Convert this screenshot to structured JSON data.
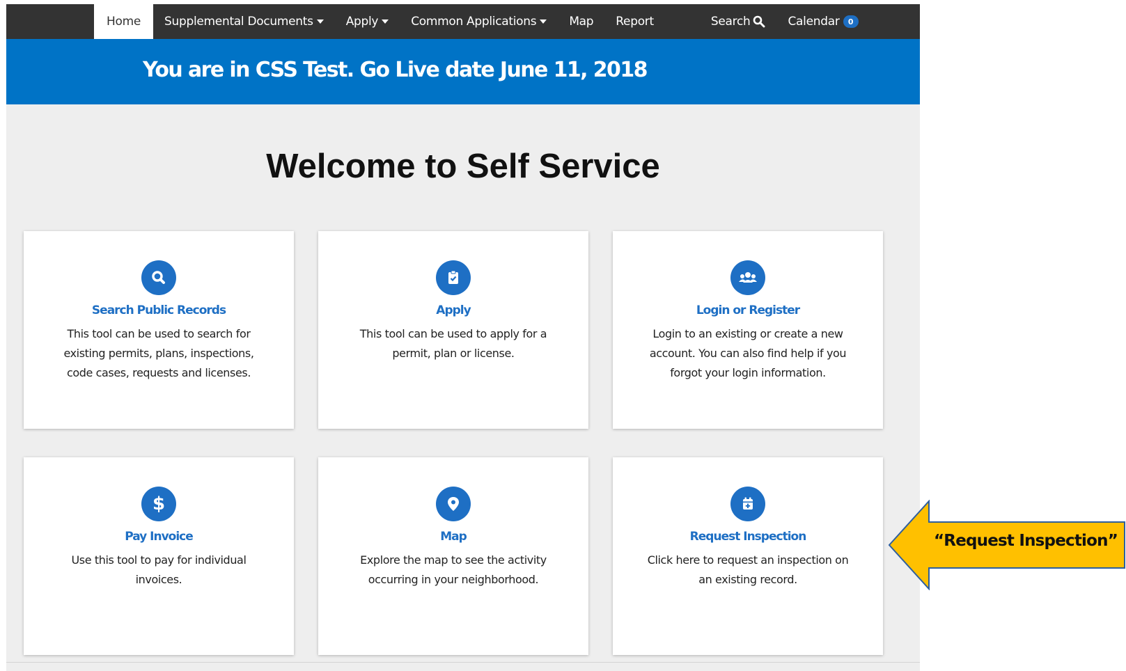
{
  "nav": {
    "home": "Home",
    "supplemental": "Supplemental Documents",
    "apply": "Apply",
    "common": "Common Applications",
    "map": "Map",
    "report": "Report",
    "search": "Search",
    "calendar": "Calendar",
    "calendar_count": "0"
  },
  "banner": {
    "text": "You are in CSS Test.  Go Live date June 11, 2018"
  },
  "welcome": "Welcome to Self Service",
  "cards": [
    {
      "title": "Search Public Records",
      "desc": "This tool can be used to search for existing permits, plans, inspections, code cases, requests and licenses.",
      "icon": "search-icon"
    },
    {
      "title": "Apply",
      "desc": "This tool can be used to apply for a permit, plan or license.",
      "icon": "clipboard-check-icon"
    },
    {
      "title": "Login or Register",
      "desc": "Login to an existing or create a new account. You can also find help if you forgot your login information.",
      "icon": "users-icon"
    },
    {
      "title": "Pay Invoice",
      "desc": "Use this tool to pay for individual invoices.",
      "icon": "dollar-icon"
    },
    {
      "title": "Map",
      "desc": "Explore the map to see the activity occurring in your neighborhood.",
      "icon": "map-pin-icon"
    },
    {
      "title": "Request Inspection",
      "desc": "Click here to request an inspection on an existing record.",
      "icon": "calendar-plus-icon"
    }
  ],
  "callout": "“Request Inspection”",
  "colors": {
    "nav_bg": "#333333",
    "banner_bg": "#0073c6",
    "accent": "#1e6fc4",
    "page_bg": "#eeeeee",
    "callout_fill": "#ffc000",
    "callout_border": "#2e5f9e"
  }
}
